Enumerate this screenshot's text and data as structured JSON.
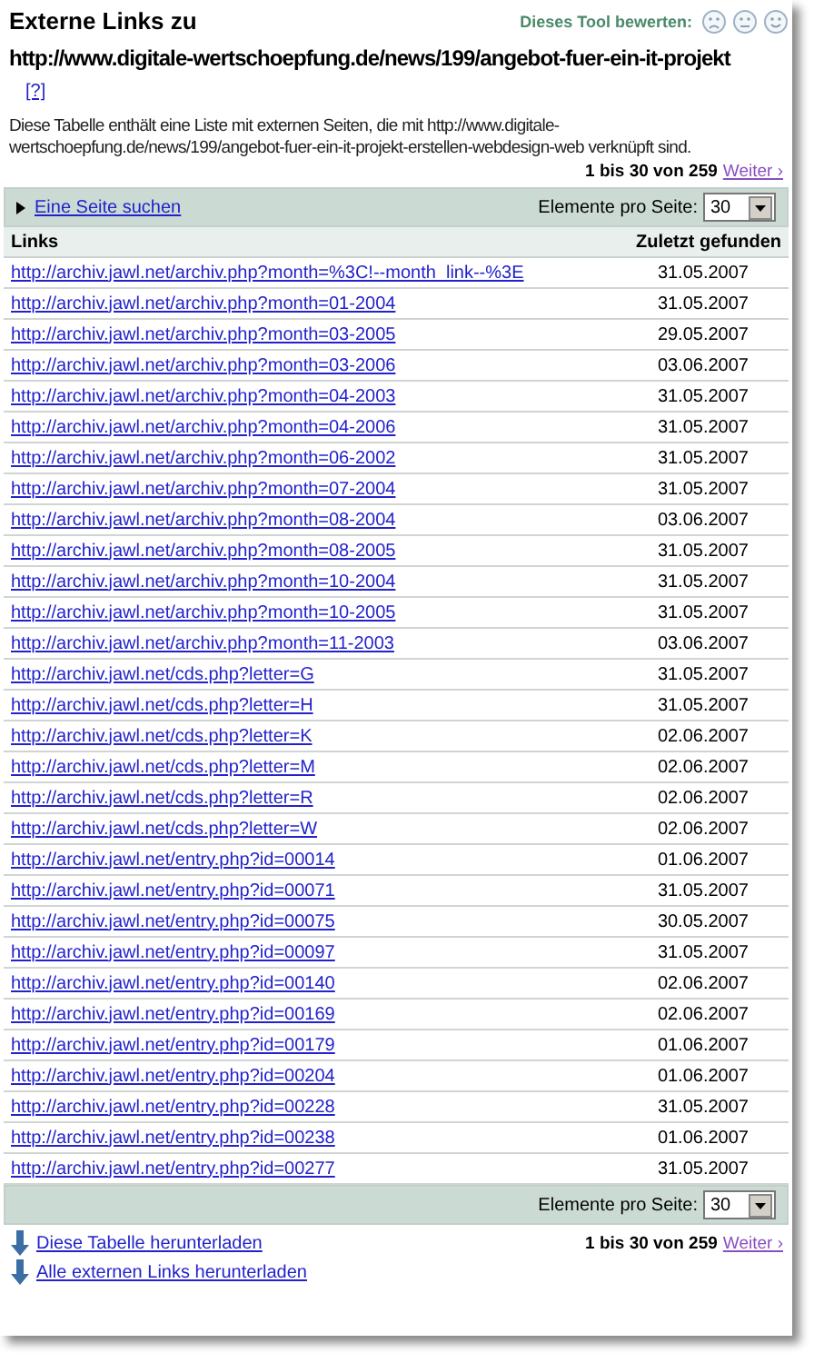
{
  "title": "Externe Links zu",
  "rating": {
    "label": "Dieses Tool bewerten:"
  },
  "url": "http://www.digitale-wertschoepfung.de/news/199/angebot-fuer-ein-it-projekt",
  "help_link": "[?]",
  "description": "Diese Tabelle enthält eine Liste mit externen Seiten, die mit http://www.digitale-wertschoepfung.de/news/199/angebot-fuer-ein-it-projekt-erstellen-webdesign-web verknüpft sind.",
  "pagination_top": {
    "range": "1 bis 30 von 259",
    "next": "Weiter ›"
  },
  "toolbar_top": {
    "search_link": "Eine Seite suchen",
    "per_page_label": "Elemente pro Seite:",
    "per_page": "30"
  },
  "table": {
    "columns": [
      "Links",
      "Zuletzt gefunden"
    ],
    "rows": [
      [
        "http://archiv.jawl.net/archiv.php?month=%3C!--month_link--%3E",
        "31.05.2007"
      ],
      [
        "http://archiv.jawl.net/archiv.php?month=01-2004",
        "31.05.2007"
      ],
      [
        "http://archiv.jawl.net/archiv.php?month=03-2005",
        "29.05.2007"
      ],
      [
        "http://archiv.jawl.net/archiv.php?month=03-2006",
        "03.06.2007"
      ],
      [
        "http://archiv.jawl.net/archiv.php?month=04-2003",
        "31.05.2007"
      ],
      [
        "http://archiv.jawl.net/archiv.php?month=04-2006",
        "31.05.2007"
      ],
      [
        "http://archiv.jawl.net/archiv.php?month=06-2002",
        "31.05.2007"
      ],
      [
        "http://archiv.jawl.net/archiv.php?month=07-2004",
        "31.05.2007"
      ],
      [
        "http://archiv.jawl.net/archiv.php?month=08-2004",
        "03.06.2007"
      ],
      [
        "http://archiv.jawl.net/archiv.php?month=08-2005",
        "31.05.2007"
      ],
      [
        "http://archiv.jawl.net/archiv.php?month=10-2004",
        "31.05.2007"
      ],
      [
        "http://archiv.jawl.net/archiv.php?month=10-2005",
        "31.05.2007"
      ],
      [
        "http://archiv.jawl.net/archiv.php?month=11-2003",
        "03.06.2007"
      ],
      [
        "http://archiv.jawl.net/cds.php?letter=G",
        "31.05.2007"
      ],
      [
        "http://archiv.jawl.net/cds.php?letter=H",
        "31.05.2007"
      ],
      [
        "http://archiv.jawl.net/cds.php?letter=K",
        "02.06.2007"
      ],
      [
        "http://archiv.jawl.net/cds.php?letter=M",
        "02.06.2007"
      ],
      [
        "http://archiv.jawl.net/cds.php?letter=R",
        "02.06.2007"
      ],
      [
        "http://archiv.jawl.net/cds.php?letter=W",
        "02.06.2007"
      ],
      [
        "http://archiv.jawl.net/entry.php?id=00014",
        "01.06.2007"
      ],
      [
        "http://archiv.jawl.net/entry.php?id=00071",
        "31.05.2007"
      ],
      [
        "http://archiv.jawl.net/entry.php?id=00075",
        "30.05.2007"
      ],
      [
        "http://archiv.jawl.net/entry.php?id=00097",
        "31.05.2007"
      ],
      [
        "http://archiv.jawl.net/entry.php?id=00140",
        "02.06.2007"
      ],
      [
        "http://archiv.jawl.net/entry.php?id=00169",
        "02.06.2007"
      ],
      [
        "http://archiv.jawl.net/entry.php?id=00179",
        "01.06.2007"
      ],
      [
        "http://archiv.jawl.net/entry.php?id=00204",
        "01.06.2007"
      ],
      [
        "http://archiv.jawl.net/entry.php?id=00228",
        "31.05.2007"
      ],
      [
        "http://archiv.jawl.net/entry.php?id=00238",
        "01.06.2007"
      ],
      [
        "http://archiv.jawl.net/entry.php?id=00277",
        "31.05.2007"
      ]
    ]
  },
  "toolbar_bottom": {
    "per_page_label": "Elemente pro Seite:",
    "per_page": "30"
  },
  "downloads": [
    "Diese Tabelle herunterladen",
    "Alle externen Links herunterladen"
  ],
  "pagination_bottom": {
    "range": "1 bis 30 von 259",
    "next": "Weiter ›"
  }
}
